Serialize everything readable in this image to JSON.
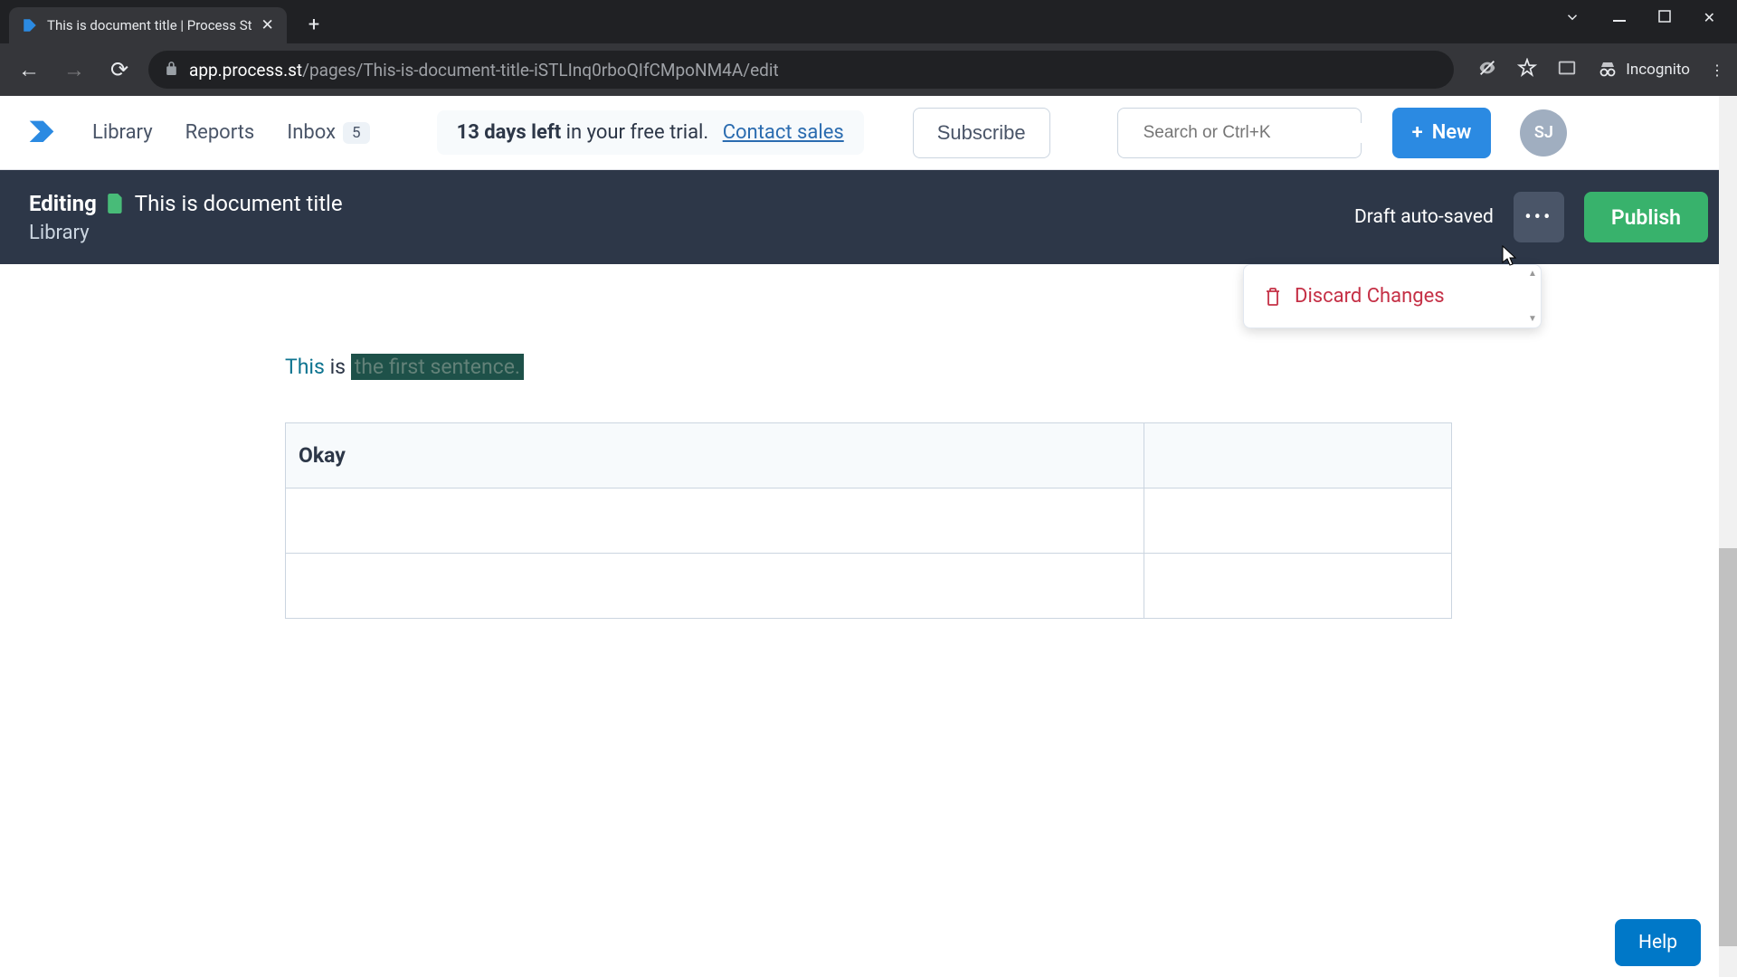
{
  "browser": {
    "tab_title": "This is document title | Process St",
    "url_domain": "app.process.st",
    "url_path": "/pages/This-is-document-title-iSTLInq0rboQIfCMpoNM4A/edit",
    "incognito_label": "Incognito"
  },
  "header": {
    "nav": {
      "library": "Library",
      "reports": "Reports",
      "inbox": "Inbox",
      "inbox_count": "5"
    },
    "trial": {
      "bold": "13 days left",
      "rest": " in your free trial.",
      "contact": "Contact sales"
    },
    "subscribe": "Subscribe",
    "search_placeholder": "Search or Ctrl+K",
    "new_button": "New",
    "avatar": "SJ"
  },
  "edit_bar": {
    "editing": "Editing",
    "doc_title": "This is document title",
    "breadcrumb": "Library",
    "autosave": "Draft auto-saved",
    "publish": "Publish"
  },
  "dropdown": {
    "discard": "Discard Changes"
  },
  "document": {
    "sentence_part1": "This",
    "sentence_part2": " is ",
    "sentence_highlighted": "the first sentence.",
    "table": {
      "r0c0": "Okay",
      "r0c1": "",
      "r1c0": "",
      "r1c1": "",
      "r2c0": "",
      "r2c1": ""
    }
  },
  "help": "Help"
}
